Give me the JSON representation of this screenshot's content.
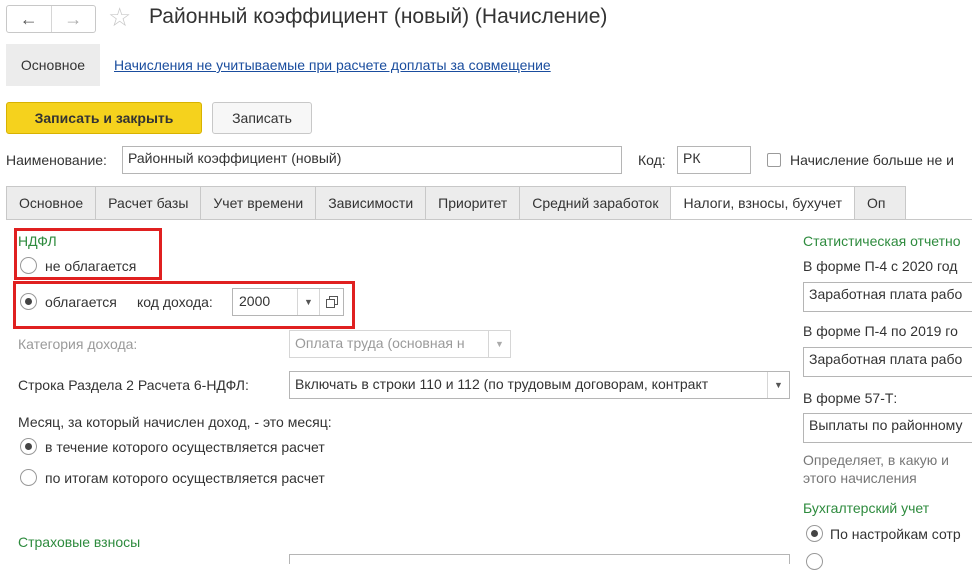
{
  "window": {
    "title": "Районный коэффициент (новый) (Начисление)"
  },
  "section_nav": {
    "main": "Основное",
    "link": "Начисления не учитываемые при расчете доплаты за совмещение"
  },
  "toolbar": {
    "save_close": "Записать и закрыть",
    "save": "Записать"
  },
  "header_fields": {
    "name_label": "Наименование:",
    "name_value": "Районный коэффициент (новый)",
    "code_label": "Код:",
    "code_value": "РК",
    "not_used_label": "Начисление больше не и"
  },
  "tabs": [
    {
      "label": "Основное"
    },
    {
      "label": "Расчет базы"
    },
    {
      "label": "Учет времени"
    },
    {
      "label": "Зависимости"
    },
    {
      "label": "Приоритет"
    },
    {
      "label": "Средний заработок"
    },
    {
      "label": "Налоги, взносы, бухучет"
    },
    {
      "label": "Оп"
    }
  ],
  "ndfl": {
    "title": "НДФЛ",
    "not_taxed": "не облагается",
    "taxed": "облагается",
    "income_code_label": "код дохода:",
    "income_code_value": "2000",
    "category_label": "Категория дохода:",
    "category_value": "Оплата труда (основная н",
    "section2_label": "Строка Раздела 2 Расчета 6-НДФЛ:",
    "section2_value": "Включать в строки 110 и 112 (по трудовым договорам, контракт",
    "month_question": "Месяц, за который начислен доход, - это месяц:",
    "month_option1": "в течение которого осуществляется расчет",
    "month_option2": "по итогам которого осуществляется расчет"
  },
  "insurance": {
    "title": "Страховые взносы"
  },
  "stats": {
    "title": "Статистическая отчетно",
    "p4_2020_label": "В форме П-4 с 2020 год",
    "p4_2020_value": "Заработная плата рабо",
    "p4_2019_label": "В форме П-4 по 2019 го",
    "p4_2019_value": "Заработная плата рабо",
    "f57t_label": "В форме 57-Т:",
    "f57t_value": "Выплаты по районному",
    "note_line1": "Определяет, в какую и",
    "note_line2": "этого начисления"
  },
  "accounting": {
    "title": "Бухгалтерский учет",
    "option1": "По настройкам сотр"
  }
}
